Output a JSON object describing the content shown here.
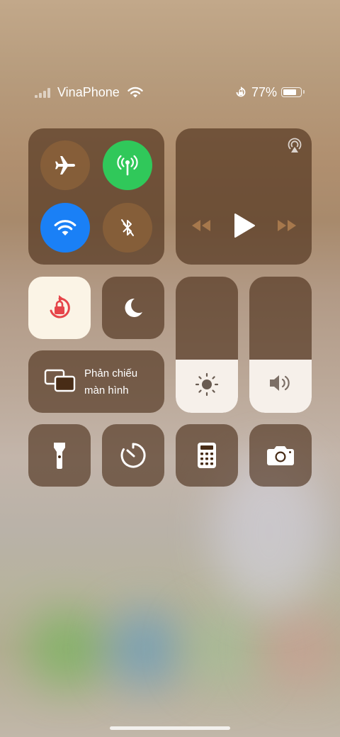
{
  "status_bar": {
    "carrier": "VinaPhone",
    "battery_percent": "77%",
    "battery_level": 0.77,
    "signal_bars_filled": 0,
    "icons": [
      "signal-icon",
      "wifi-icon",
      "orientation-lock-icon",
      "battery-icon"
    ]
  },
  "connectivity": {
    "airplane": {
      "icon": "airplane-icon",
      "on": false
    },
    "cellular": {
      "icon": "cellular-data-icon",
      "on": true,
      "color": "#30c85a"
    },
    "wifi": {
      "icon": "wifi-icon",
      "on": true,
      "color": "#1a80f6"
    },
    "bluetooth": {
      "icon": "bluetooth-off-icon",
      "on": false
    }
  },
  "media": {
    "icons": [
      "airplay-icon",
      "rewind-icon",
      "play-icon",
      "fast-forward-icon"
    ]
  },
  "toggles": {
    "orientation_lock": {
      "icon": "orientation-lock-icon",
      "on": true,
      "accent": "#e6454a"
    },
    "do_not_disturb": {
      "icon": "moon-icon",
      "on": false
    }
  },
  "screen_mirroring": {
    "line1": "Phản chiếu",
    "line2": "màn hình",
    "icon": "screen-mirroring-icon"
  },
  "brightness": {
    "icon": "sun-icon",
    "level": 0.39
  },
  "volume": {
    "icon": "speaker-icon",
    "level": 0.39
  },
  "shortcuts": [
    {
      "icon": "flashlight-icon"
    },
    {
      "icon": "timer-icon"
    },
    {
      "icon": "calculator-icon"
    },
    {
      "icon": "camera-icon"
    }
  ]
}
